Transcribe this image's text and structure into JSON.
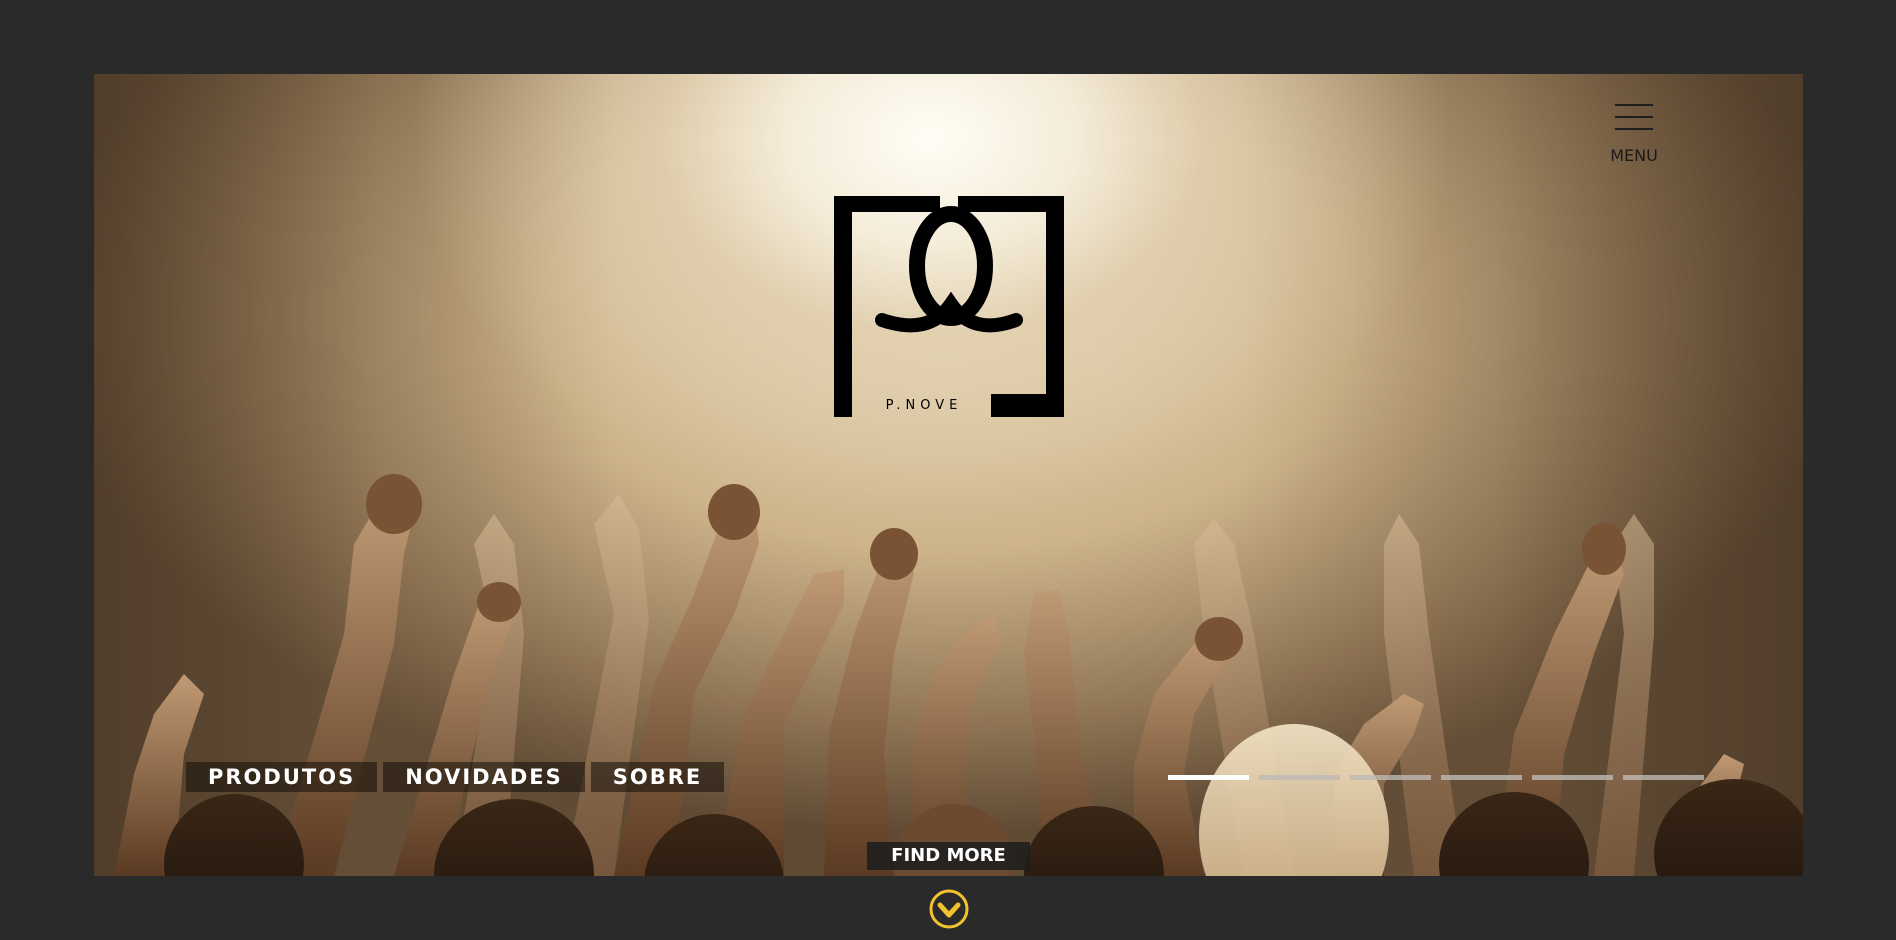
{
  "header": {
    "menu_label": "MENU",
    "menu_icon": "hamburger-icon"
  },
  "logo": {
    "wordmark": "P.NOVE",
    "icon": "p-nove-logo-icon"
  },
  "nav": {
    "items": [
      {
        "label": "PRODUTOS"
      },
      {
        "label": "NOVIDADES"
      },
      {
        "label": "SOBRE"
      }
    ]
  },
  "slider": {
    "total_slides": 6,
    "active_slide": 1
  },
  "cta": {
    "find_more_label": "FIND MORE",
    "scroll_icon": "chevron-down-circle-icon"
  },
  "colors": {
    "background": "#2a2a2a",
    "accent": "#f2c230",
    "text_light": "#ffffff",
    "text_dark": "#1a1a1a"
  }
}
